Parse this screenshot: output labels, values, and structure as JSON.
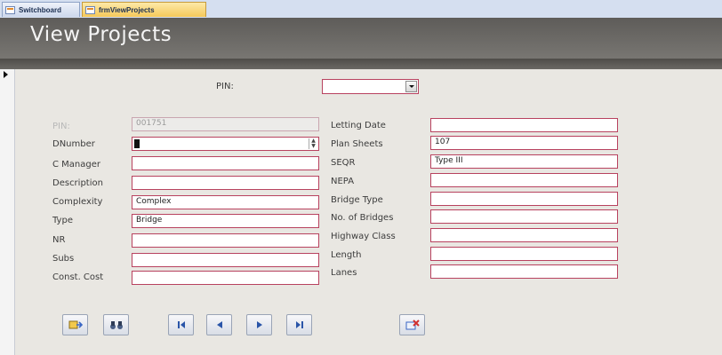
{
  "tabs": [
    {
      "label": "Switchboard"
    },
    {
      "label": "frmViewProjects"
    }
  ],
  "header": {
    "title": "View Projects"
  },
  "pin_lookup": {
    "label": "PIN:",
    "value": ""
  },
  "left_fields": [
    {
      "label": "PIN:",
      "value": "001751"
    },
    {
      "label": "DNumber",
      "value": ""
    },
    {
      "label": "C Manager",
      "value": ""
    },
    {
      "label": "Description",
      "value": ""
    },
    {
      "label": "Complexity",
      "value": "Complex"
    },
    {
      "label": "Type",
      "value": "Bridge"
    },
    {
      "label": "NR",
      "value": ""
    },
    {
      "label": "Subs",
      "value": ""
    },
    {
      "label": "Const. Cost",
      "value": ""
    }
  ],
  "right_fields": [
    {
      "label": "Letting Date",
      "value": ""
    },
    {
      "label": "Plan Sheets",
      "value": "107"
    },
    {
      "label": "SEQR",
      "value": "Type III"
    },
    {
      "label": "NEPA",
      "value": ""
    },
    {
      "label": "Bridge Type",
      "value": ""
    },
    {
      "label": "No. of Bridges",
      "value": ""
    },
    {
      "label": "Highway Class",
      "value": ""
    },
    {
      "label": "Length",
      "value": ""
    },
    {
      "label": "Lanes",
      "value": ""
    }
  ],
  "icons": {
    "open_form": "open-form-icon",
    "find": "binoculars-icon",
    "first": "first-record-icon",
    "prev": "previous-record-icon",
    "next": "next-record-icon",
    "last": "last-record-icon",
    "close": "close-form-icon"
  },
  "colors": {
    "field_border": "#b8425f",
    "header_bg": "#6b6966",
    "form_bg": "#e9e7e2",
    "tab_active": "#f6c95a"
  }
}
